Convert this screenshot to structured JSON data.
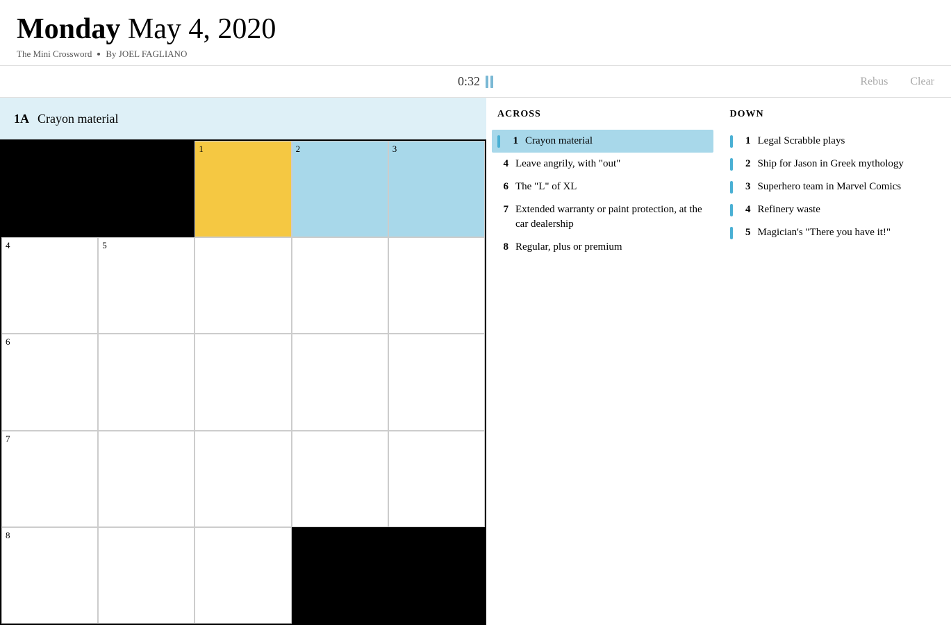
{
  "header": {
    "day": "Monday",
    "date": "May 4, 2020",
    "subtitle": "The Mini Crossword",
    "separator": "■",
    "byline": "By JOEL FAGLIANO"
  },
  "toolbar": {
    "timer": "0:32",
    "rebus_label": "Rebus",
    "clear_label": "Clear"
  },
  "clue_banner": {
    "number": "1A",
    "text": "Crayon material"
  },
  "across_title": "ACROSS",
  "down_title": "DOWN",
  "across_clues": [
    {
      "num": "1",
      "text": "Crayon material",
      "active": true
    },
    {
      "num": "4",
      "text": "Leave angrily, with \"out\"",
      "active": false
    },
    {
      "num": "6",
      "text": "The \"L\" of XL",
      "active": false
    },
    {
      "num": "7",
      "text": "Extended warranty or paint protection, at the car dealership",
      "active": false
    },
    {
      "num": "8",
      "text": "Regular, plus or premium",
      "active": false
    }
  ],
  "down_clues": [
    {
      "num": "1",
      "text": "Legal Scrabble plays",
      "active": false
    },
    {
      "num": "2",
      "text": "Ship for Jason in Greek mythology",
      "active": false
    },
    {
      "num": "3",
      "text": "Superhero team in Marvel Comics",
      "active": false
    },
    {
      "num": "4",
      "text": "Refinery waste",
      "active": false
    },
    {
      "num": "5",
      "text": "Magician's \"There you have it!\"",
      "active": false
    }
  ],
  "grid": {
    "rows": 5,
    "cols": 5,
    "cells": [
      {
        "row": 0,
        "col": 0,
        "type": "black"
      },
      {
        "row": 0,
        "col": 1,
        "type": "black"
      },
      {
        "row": 0,
        "col": 2,
        "type": "yellow",
        "num": "1"
      },
      {
        "row": 0,
        "col": 3,
        "type": "blue",
        "num": "2"
      },
      {
        "row": 0,
        "col": 4,
        "type": "blue",
        "num": "3"
      },
      {
        "row": 1,
        "col": 0,
        "type": "white",
        "num": "4"
      },
      {
        "row": 1,
        "col": 1,
        "type": "white",
        "num": "5"
      },
      {
        "row": 1,
        "col": 2,
        "type": "white"
      },
      {
        "row": 1,
        "col": 3,
        "type": "white"
      },
      {
        "row": 1,
        "col": 4,
        "type": "white"
      },
      {
        "row": 2,
        "col": 0,
        "type": "white",
        "num": "6"
      },
      {
        "row": 2,
        "col": 1,
        "type": "white"
      },
      {
        "row": 2,
        "col": 2,
        "type": "white"
      },
      {
        "row": 2,
        "col": 3,
        "type": "white"
      },
      {
        "row": 2,
        "col": 4,
        "type": "white"
      },
      {
        "row": 3,
        "col": 0,
        "type": "white",
        "num": "7"
      },
      {
        "row": 3,
        "col": 1,
        "type": "white"
      },
      {
        "row": 3,
        "col": 2,
        "type": "white"
      },
      {
        "row": 3,
        "col": 3,
        "type": "white"
      },
      {
        "row": 3,
        "col": 4,
        "type": "white"
      },
      {
        "row": 4,
        "col": 0,
        "type": "white",
        "num": "8"
      },
      {
        "row": 4,
        "col": 1,
        "type": "white"
      },
      {
        "row": 4,
        "col": 2,
        "type": "white"
      },
      {
        "row": 4,
        "col": 3,
        "type": "black"
      },
      {
        "row": 4,
        "col": 4,
        "type": "black"
      }
    ]
  }
}
